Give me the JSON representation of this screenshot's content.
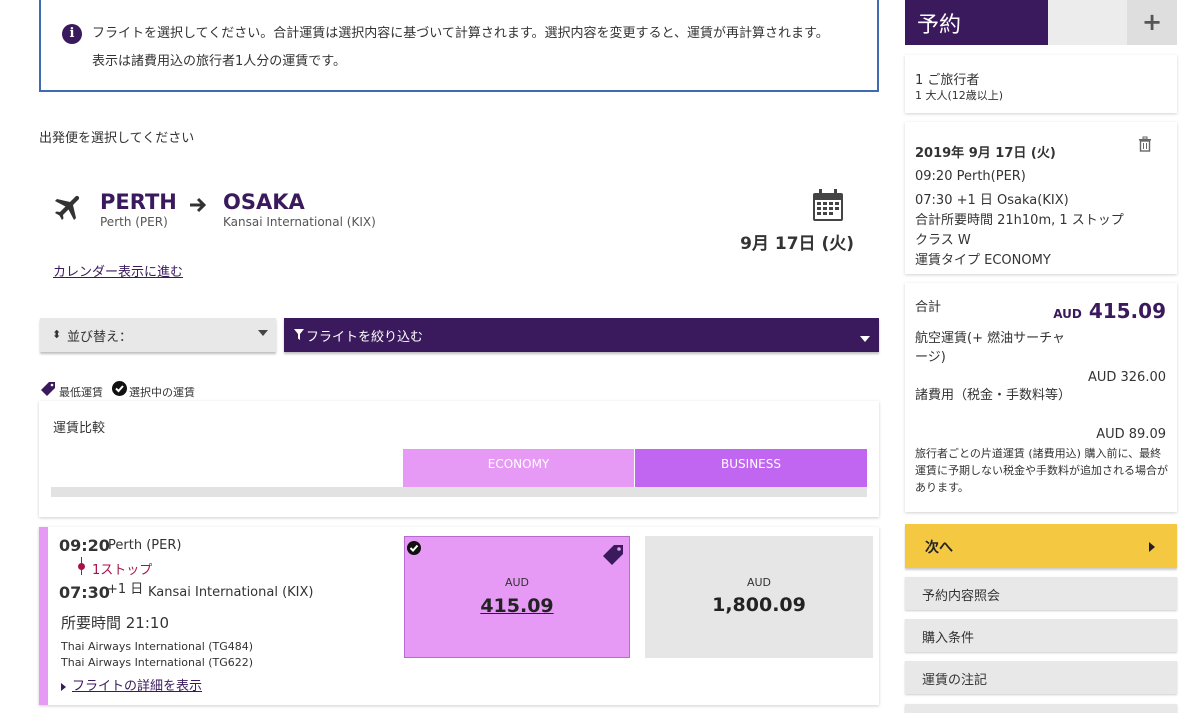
{
  "info": {
    "line1": "フライトを選択してください。合計運賃は選択内容に基づいて計算されます。選択内容を変更すると、運賃が再計算されます。",
    "line2": "表示は諸費用込の旅行者1人分の運賃です。"
  },
  "section_title": "出発便を選択してください",
  "route": {
    "origin_code": "PERTH",
    "origin_name": "Perth (PER)",
    "dest_code": "OSAKA",
    "dest_name": "Kansai International (KIX)",
    "date": "9月 17日 (火)",
    "calendar_link": "カレンダー表示に進む"
  },
  "toolbar": {
    "sort_label": "並び替え：",
    "filter_label": "フライトを絞り込む"
  },
  "legend": {
    "lowest": "最低運賃",
    "selected": "選択中の運賃"
  },
  "compare": {
    "title": "運賃比較",
    "col_economy": "ECONOMY",
    "col_business": "BUSINESS"
  },
  "flight": {
    "dep_time": "09:20",
    "dep_city": "Perth (PER)",
    "stops": "1ストップ",
    "arr_time": "07:30",
    "arr_day": "+1 日",
    "arr_city": "Kansai International (KIX)",
    "duration": "所要時間 21:10",
    "carriers": [
      "Thai Airways International (TG484)",
      "Thai Airways International (TG622)"
    ],
    "details_link": "フライトの詳細を表示",
    "economy": {
      "currency": "AUD",
      "amount": "415.09"
    },
    "business": {
      "currency": "AUD",
      "amount": "1,800.09"
    }
  },
  "panel": {
    "title": "予約",
    "plus": "+",
    "pax_line1": "1 ご旅行者",
    "pax_line2": "1 大人(12歳以上)",
    "trip": {
      "date": "2019年 9月 17日 (火)",
      "dep": "09:20 Perth(PER)",
      "arr": "07:30 +1 日 Osaka(KIX)",
      "duration": "合計所要時間 21h10m, 1 ストップ",
      "cabin": "クラス W",
      "fare_type": "運賃タイプ ECONOMY"
    },
    "total": {
      "label": "合計",
      "currency": "AUD",
      "amount": "415.09",
      "fare_label": "航空運賃(+ 燃油サーチャージ)",
      "fare_value": "AUD 326.00",
      "tax_label": "諸費用（税金・手数料等）",
      "tax_value": "AUD 89.09",
      "note": "旅行者ごとの片道運賃 (諸費用込) 購入前に、最終運賃に予期しない税金や手数料が追加される場合があります。"
    },
    "next_button": "次へ",
    "links": [
      "予約内容照会",
      "購入条件",
      "運賃の注記"
    ]
  },
  "colors": {
    "brand_purple": "#3a1a5c",
    "economy_pink": "#e79af5",
    "business_violet": "#c066f0",
    "next_yellow": "#f5c842",
    "stop_red": "#a8124a"
  }
}
